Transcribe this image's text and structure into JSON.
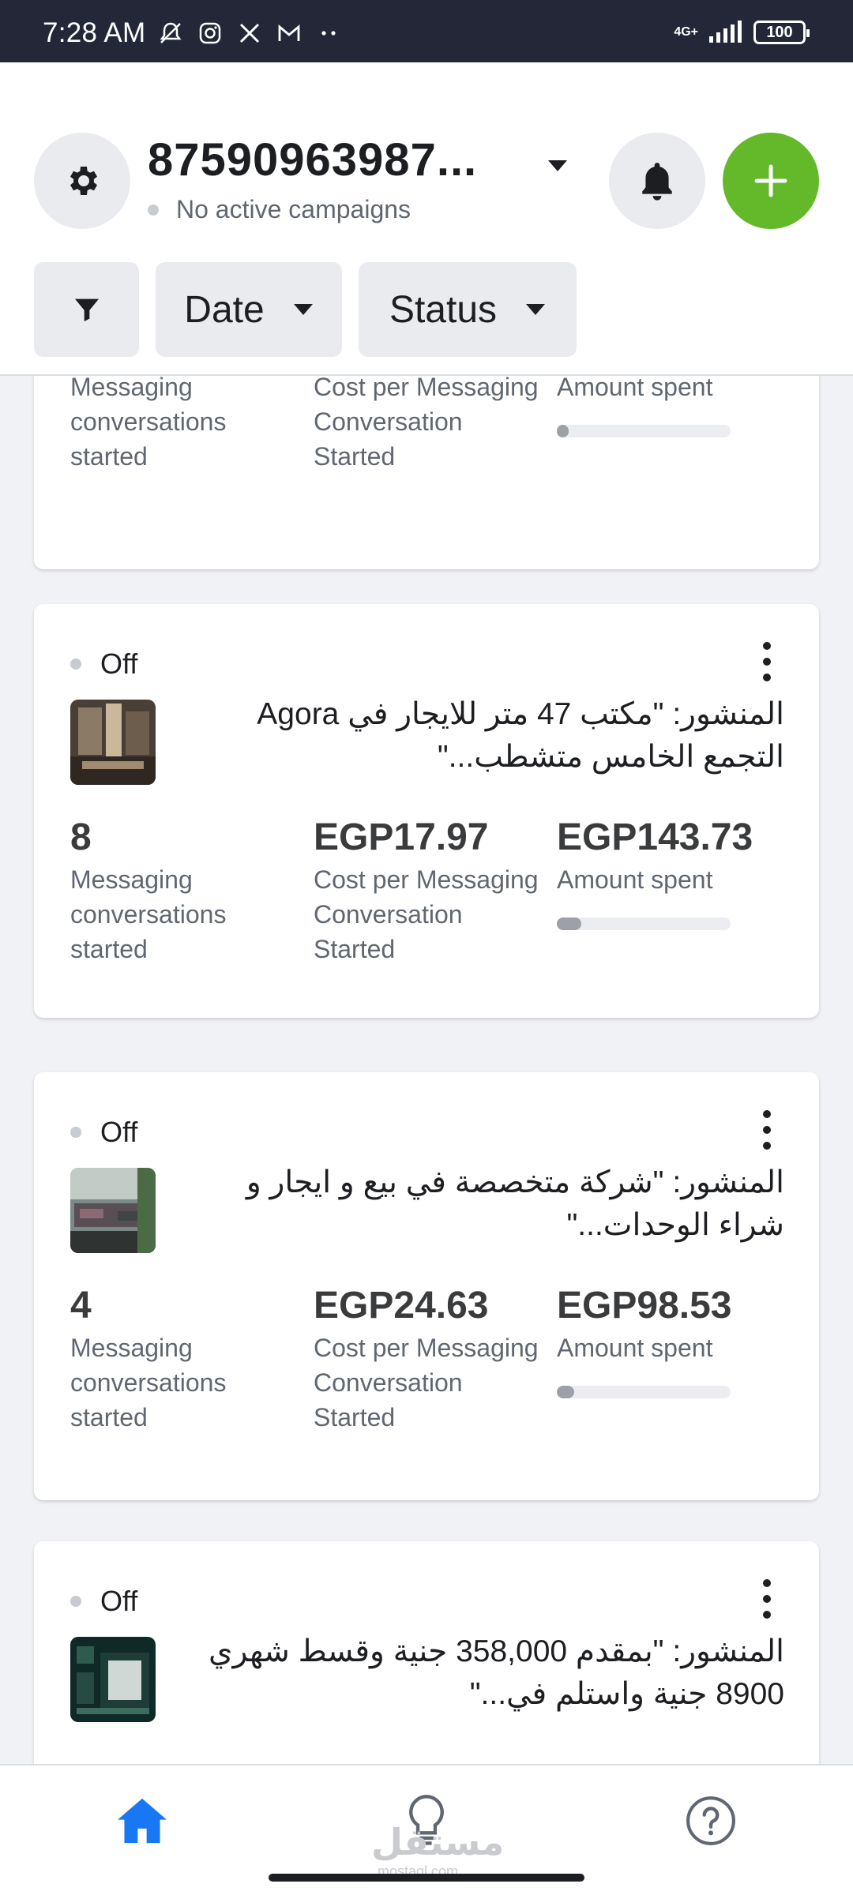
{
  "status_bar": {
    "time": "7:28 AM",
    "network": "4G+",
    "battery": "100"
  },
  "header": {
    "account_id": "87590963987...",
    "account_status": "No active campaigns",
    "filters": {
      "date": "Date",
      "status": "Status"
    }
  },
  "cards": [
    {
      "partial": true,
      "metrics": [
        {
          "value": "",
          "label": "Messaging conversations started"
        },
        {
          "value": "",
          "label": "Cost per Messaging Conversation Started"
        },
        {
          "value": "",
          "label": "Amount spent",
          "fill": 0.07
        }
      ]
    },
    {
      "status": "Off",
      "post_text": "المنشور: \"مكتب 47 متر للايجار في Agora التجمع الخامس متشطب...\"",
      "metrics": [
        {
          "value": "8",
          "label": "Messaging conversations started"
        },
        {
          "value": "EGP17.97",
          "label": "Cost per Messaging Conversation Started"
        },
        {
          "value": "EGP143.73",
          "label": "Amount spent",
          "fill": 0.14
        }
      ]
    },
    {
      "status": "Off",
      "post_text": "المنشور: \"شركة متخصصة في بيع و ايجار و شراء الوحدات...\"",
      "metrics": [
        {
          "value": "4",
          "label": "Messaging conversations started"
        },
        {
          "value": "EGP24.63",
          "label": "Cost per Messaging Conversation Started"
        },
        {
          "value": "EGP98.53",
          "label": "Amount spent",
          "fill": 0.1
        }
      ]
    },
    {
      "status": "Off",
      "post_text": "المنشور: \"بمقدم 358,000 جنية وقسط شهري 8900 جنية واستلم في...\""
    }
  ],
  "watermark": {
    "main": "مستقل",
    "sub": "mostaql.com"
  },
  "colors": {
    "accent_green": "#63b92a",
    "home_blue": "#1877f2"
  }
}
